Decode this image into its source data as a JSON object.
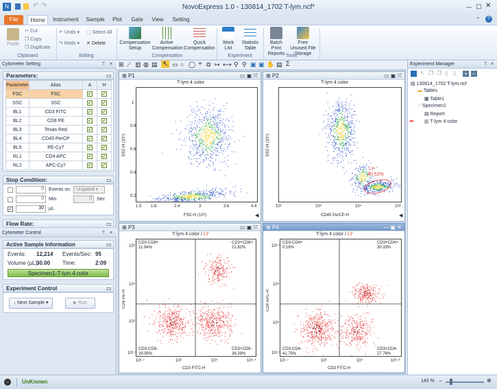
{
  "window": {
    "title": "NovoExpress 1.0 - 130814_1702 T-lym.ncf*"
  },
  "ribbon": {
    "tabs": [
      "File",
      "Home",
      "Instrument",
      "Sample",
      "Plot",
      "Gate",
      "View",
      "Setting"
    ],
    "clipboard": {
      "paste": "Paste",
      "cut": "Cut",
      "copy": "Copy",
      "duplicate": "Duplicate",
      "label": "Clipboard"
    },
    "editing": {
      "undo": "Undo",
      "redo": "Redo",
      "select_all": "Select All",
      "delete": "Delete",
      "label": "Editing"
    },
    "compensation": {
      "setup": "Compensation Setup",
      "active": "Active Compensation",
      "quick": "Quick Compensation",
      "label": "Compensation"
    },
    "experiment": {
      "work_list": "Work List",
      "statistic_table": "Statistic Table",
      "label": "Experiment"
    },
    "tools": {
      "batch_print": "Batch Print Reports",
      "free_unused": "Free Unused File Storage",
      "label": "Tools"
    }
  },
  "left": {
    "cytometer_setting": "Cytometer Setting",
    "parameters_title": "Parameters:",
    "param_headers": [
      "Parameter",
      "Alias",
      "A",
      "H"
    ],
    "params": [
      [
        "FSC",
        "FSC"
      ],
      [
        "SSC",
        "SSC"
      ],
      [
        "BL1",
        "CD3 FITC"
      ],
      [
        "BL2",
        "CD8 PE"
      ],
      [
        "BL3",
        "Texas Red"
      ],
      [
        "BL4",
        "CD45 PerCP"
      ],
      [
        "BL5",
        "PE-Cy7"
      ],
      [
        "RL1",
        "CD4 APC"
      ],
      [
        "RL2",
        "APC-Cy7"
      ]
    ],
    "stop_condition": "Stop Condition:",
    "events_on": "Events on",
    "ungated": "Ungated",
    "min": "Min",
    "sec": "Sec",
    "ul": "µL",
    "stop_values": [
      "0",
      "0",
      "30",
      "0"
    ],
    "flow_rate": "Flow Rate:",
    "cytometer_control": "Cytometer Control",
    "active_sample": "Active Sample Information",
    "events_label": "Events:",
    "events_value": "12,214",
    "events_sec_label": "Events/Sec:",
    "events_sec_value": "95",
    "volume_label": "Volume (µL)",
    "volume_value": "30.00",
    "time_label": "Time:",
    "time_value": "2:09",
    "sample_name": "Specimen1-T-lym 4 color",
    "experiment_control": "Experiment Control",
    "next_sample": "Next Sample",
    "run": "Run"
  },
  "plots": {
    "p1": {
      "name": "P1",
      "title": "T-lym 4 color",
      "xlabel": "FSC-H (10⁶)",
      "ylabel": "SSC-H (10⁵)",
      "xticks": [
        "1.5",
        "1.8",
        "2.4",
        "3",
        "3.6",
        "4.4"
      ],
      "yticks": [
        "0.2",
        "0.4",
        "0.6",
        "0.8",
        "1"
      ]
    },
    "p2": {
      "name": "P2",
      "title": "T-lym 4 color",
      "xlabel": "CD45 PerCP-H",
      "ylabel": "SSC-H (10⁵)",
      "xticks": [
        "10²",
        "10³",
        "10⁴",
        "10⁵"
      ],
      "gate_label": "LY",
      "gate_pct": "40.52%"
    },
    "p3": {
      "name": "P3",
      "title": "T-lym 4 color / ",
      "gate": "LY",
      "xlabel": "CD3 FITC-H",
      "ylabel": "CD8 PE-H",
      "quad": [
        [
          "CD3-CD8+",
          "11.94%"
        ],
        [
          "CD3+CD8+",
          "21.82%"
        ],
        [
          "CD3-CD8-",
          "29.95%"
        ],
        [
          "CD3+CD8-",
          "36.29%"
        ]
      ],
      "xticks": [
        "10¹·⁷",
        "10³",
        "10⁴",
        "10⁵·⁴"
      ],
      "yticks": [
        "10¹·⁷",
        "10³",
        "10⁴",
        "10⁵"
      ]
    },
    "p4": {
      "name": "P4",
      "title": "T-lym 4 color / ",
      "gate": "LY",
      "xlabel": "CD3 FITC-H",
      "ylabel": "CD4 APC-H",
      "quad": [
        [
          "CD3-CD4+",
          "0.16%"
        ],
        [
          "CD3+CD4+",
          "30.33%"
        ],
        [
          "CD3-CD4-",
          "41.75%"
        ],
        [
          "CD3+CD4-",
          "27.76%"
        ]
      ],
      "xticks": [
        "10¹·⁷",
        "10³",
        "10⁴",
        "10⁵·³"
      ],
      "yticks": [
        "10²·³",
        "10³",
        "10⁴",
        "10⁵·³"
      ]
    }
  },
  "experiment_manager": {
    "title": "Experiment Manager",
    "tree": [
      "130814_1702 T-lym.ncf",
      "Tables",
      "Table1",
      "Specimen1",
      "Report",
      "T-lym 4 color"
    ]
  },
  "status": {
    "state": "UnKnown",
    "zoom": "143 %"
  },
  "colors": {
    "accent": "#e8782a",
    "active_plot": "#7498c9",
    "scatter_blue": "#2e4fc9",
    "scatter_red": "#e53b3b"
  }
}
